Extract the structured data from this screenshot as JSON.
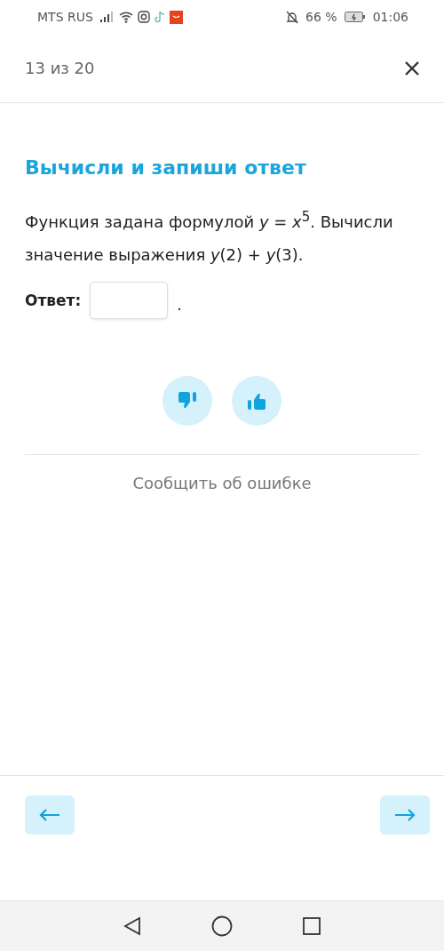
{
  "status_bar": {
    "carrier": "MTS RUS",
    "battery": "66 %",
    "time": "01:06"
  },
  "header": {
    "progress": "13 из 20"
  },
  "task": {
    "title": "Вычисли и запиши ответ",
    "text": "Функция задана формулой *y* = *x*$^{5}$. Вычисли значение выражения *y*(2) + *y*(3).",
    "answer_label": "Ответ:",
    "answer_suffix": "."
  },
  "report_link": "Сообщить об ошибке"
}
